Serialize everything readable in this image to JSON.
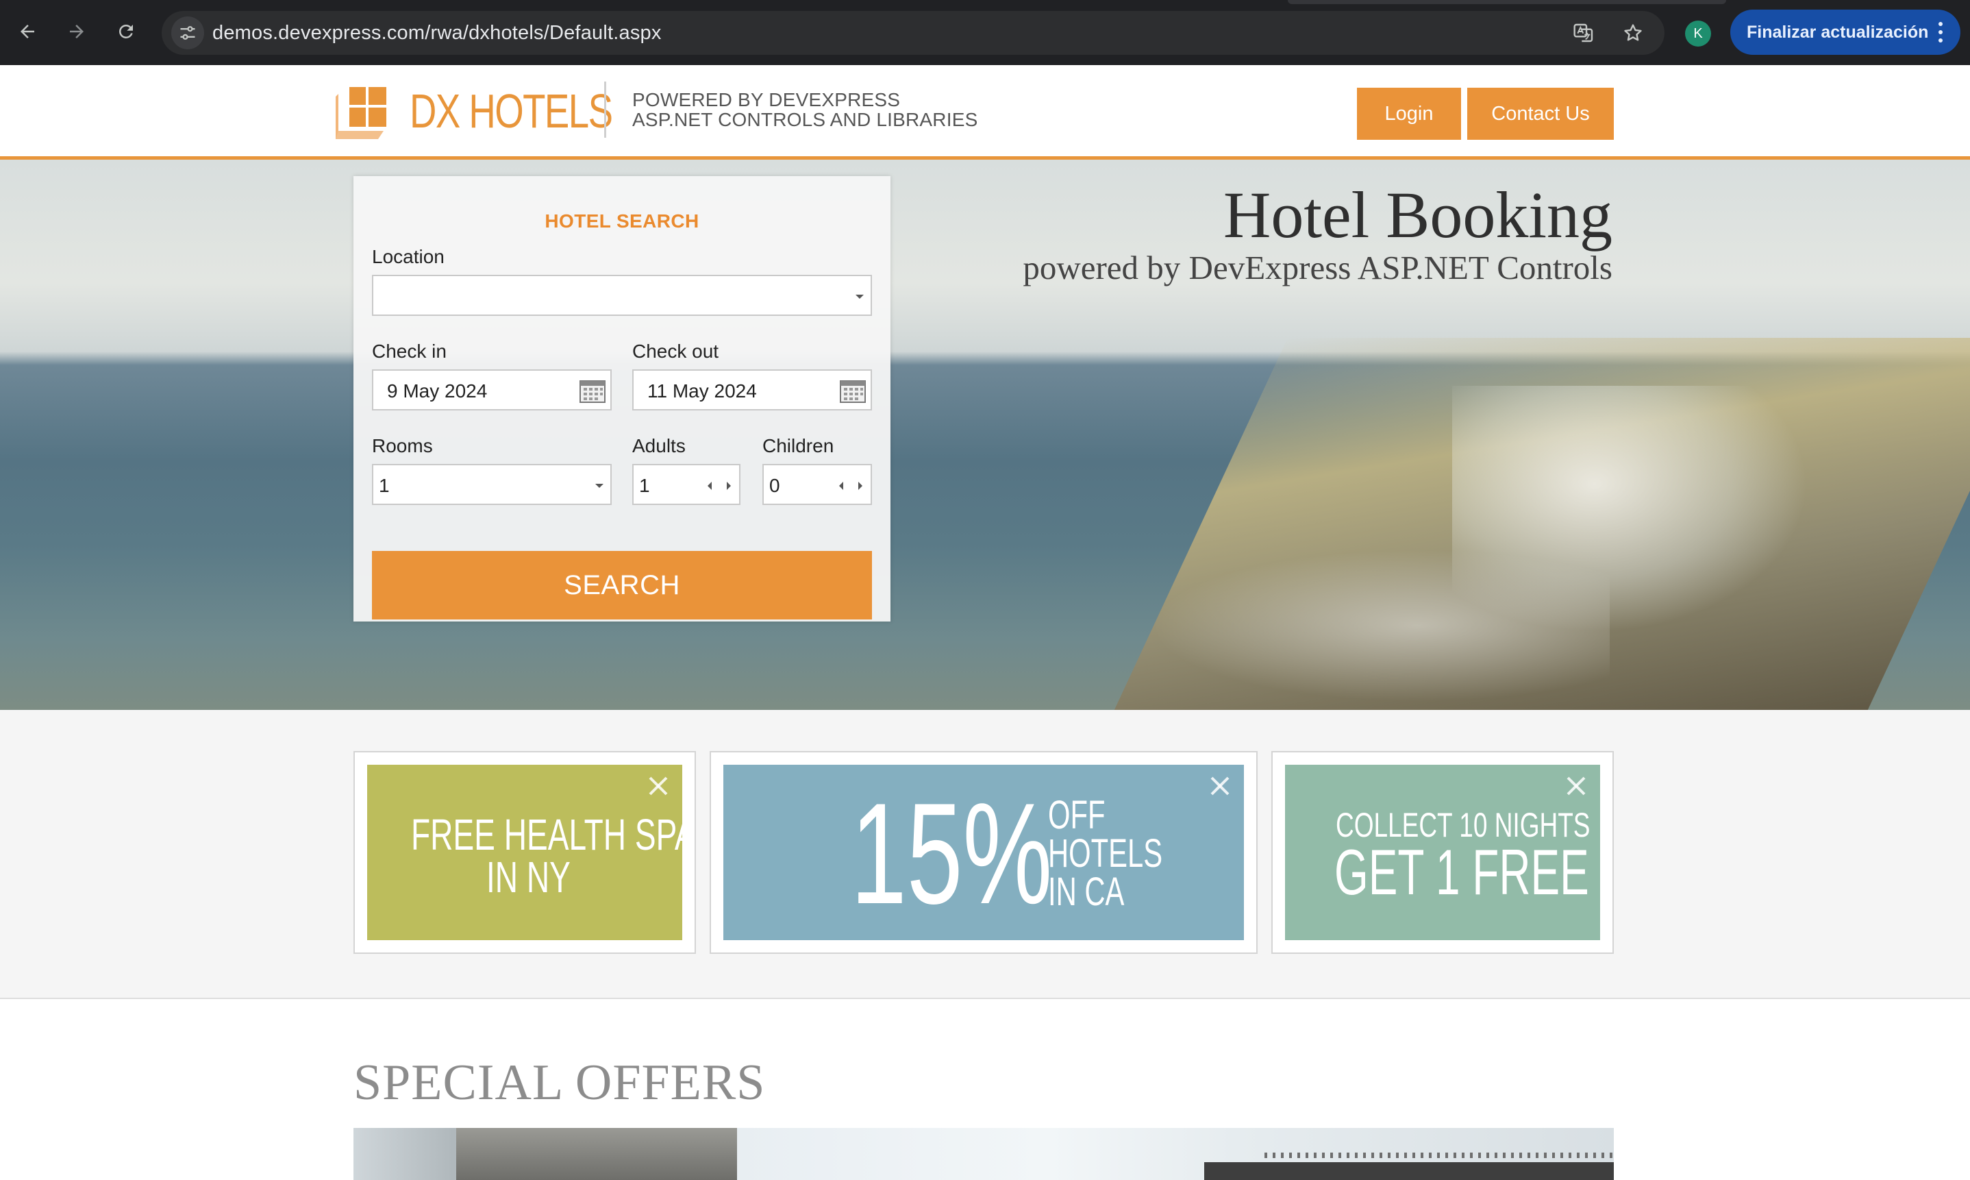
{
  "browser": {
    "url_host": "demos.devexpress.com",
    "url_path": "/rwa/dxhotels/Default.aspx",
    "profile_initial": "K",
    "update_button": "Finalizar actualización"
  },
  "header": {
    "logo_text": "DX HOTELS",
    "powered_line1": "POWERED BY DEVEXPRESS",
    "powered_line2": "ASP.NET CONTROLS AND LIBRARIES",
    "login": "Login",
    "contact": "Contact Us",
    "accent": "#ea9339"
  },
  "hero": {
    "title": "Hotel Booking",
    "subtitle": "powered by DevExpress ASP.NET Controls"
  },
  "search": {
    "title": "HOTEL SEARCH",
    "location_label": "Location",
    "location_value": "",
    "checkin_label": "Check in",
    "checkin_value": "9 May 2024",
    "checkout_label": "Check out",
    "checkout_value": "11 May 2024",
    "rooms_label": "Rooms",
    "rooms_value": "1",
    "adults_label": "Adults",
    "adults_value": "1",
    "children_label": "Children",
    "children_value": "0",
    "button": "SEARCH"
  },
  "promos": [
    {
      "line1": "FREE HEALTH SPA",
      "line2": "IN NY",
      "color": "#bcbd5c"
    },
    {
      "big": "15%",
      "line1": "OFF",
      "line2": "HOTELS",
      "line3": "IN CA",
      "color": "#84afc0"
    },
    {
      "line1": "COLLECT 10 NIGHTS",
      "line2": "GET 1 FREE",
      "color": "#92bba8"
    }
  ],
  "offers": {
    "title": "SPECIAL OFFERS"
  }
}
